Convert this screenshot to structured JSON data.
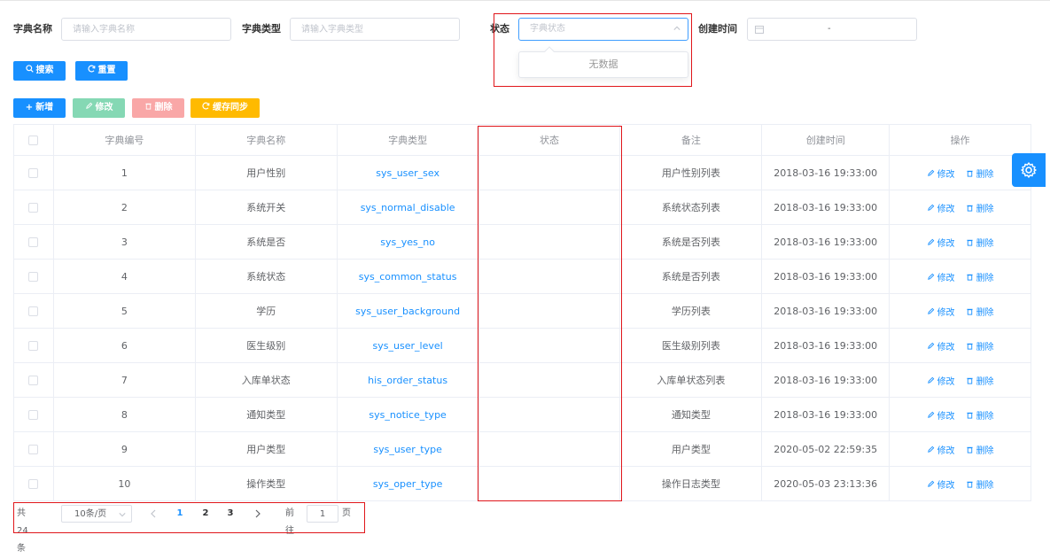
{
  "search_form": {
    "dict_name_label": "字典名称",
    "dict_name_placeholder": "请输入字典名称",
    "dict_type_label": "字典类型",
    "dict_type_placeholder": "请输入字典类型",
    "status_label": "状态",
    "status_placeholder": "字典状态",
    "status_dropdown_empty": "无数据",
    "create_time_label": "创建时间",
    "date_separator": "-"
  },
  "search_buttons": {
    "search": "搜索",
    "reset": "重置"
  },
  "toolbar": {
    "add": "新增",
    "edit": "修改",
    "delete": "删除",
    "cache_sync": "缓存同步"
  },
  "table": {
    "columns": [
      "字典编号",
      "字典名称",
      "字典类型",
      "状态",
      "备注",
      "创建时间",
      "操作"
    ],
    "rows": [
      {
        "id": "1",
        "name": "用户性别",
        "type": "sys_user_sex",
        "status": "",
        "remark": "用户性别列表",
        "created": "2018-03-16 19:33:00"
      },
      {
        "id": "2",
        "name": "系统开关",
        "type": "sys_normal_disable",
        "status": "",
        "remark": "系统状态列表",
        "created": "2018-03-16 19:33:00"
      },
      {
        "id": "3",
        "name": "系统是否",
        "type": "sys_yes_no",
        "status": "",
        "remark": "系统是否列表",
        "created": "2018-03-16 19:33:00"
      },
      {
        "id": "4",
        "name": "系统状态",
        "type": "sys_common_status",
        "status": "",
        "remark": "系统是否列表",
        "created": "2018-03-16 19:33:00"
      },
      {
        "id": "5",
        "name": "学历",
        "type": "sys_user_background",
        "status": "",
        "remark": "学历列表",
        "created": "2018-03-16 19:33:00"
      },
      {
        "id": "6",
        "name": "医生级别",
        "type": "sys_user_level",
        "status": "",
        "remark": "医生级别列表",
        "created": "2018-03-16 19:33:00"
      },
      {
        "id": "7",
        "name": "入库单状态",
        "type": "his_order_status",
        "status": "",
        "remark": "入库单状态列表",
        "created": "2018-03-16 19:33:00"
      },
      {
        "id": "8",
        "name": "通知类型",
        "type": "sys_notice_type",
        "status": "",
        "remark": "通知类型",
        "created": "2018-03-16 19:33:00"
      },
      {
        "id": "9",
        "name": "用户类型",
        "type": "sys_user_type",
        "status": "",
        "remark": "用户类型",
        "created": "2020-05-02 22:59:35"
      },
      {
        "id": "10",
        "name": "操作类型",
        "type": "sys_oper_type",
        "status": "",
        "remark": "操作日志类型",
        "created": "2020-05-03 23:13:36"
      }
    ],
    "row_action_edit": "修改",
    "row_action_delete": "删除"
  },
  "pagination": {
    "total_text": "共 24 条",
    "page_size": "10条/页",
    "pages": [
      "1",
      "2",
      "3"
    ],
    "current_page": "1",
    "goto_label": "前往",
    "goto_value": "1",
    "goto_suffix": "页"
  },
  "colors": {
    "primary": "#1890ff",
    "success": "#85d8b4",
    "danger": "#f9a7a7",
    "warning": "#ffba00",
    "annotation": "#e0161b"
  },
  "icons": [
    "search-icon",
    "refresh-icon",
    "plus-icon",
    "edit-icon",
    "trash-icon",
    "sync-icon",
    "calendar-icon",
    "chevron-up-icon",
    "chevron-down-icon",
    "gear-icon"
  ]
}
